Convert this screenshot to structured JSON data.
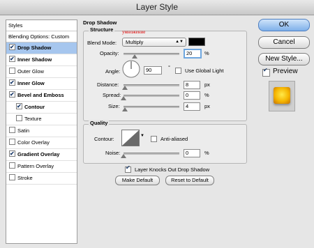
{
  "window": {
    "title": "Layer Style"
  },
  "sidebar": {
    "header": "Styles",
    "blending": "Blending Options: Custom",
    "items": [
      {
        "label": "Drop Shadow",
        "checked": true,
        "selected": true
      },
      {
        "label": "Inner Shadow",
        "checked": true
      },
      {
        "label": "Outer Glow",
        "checked": false
      },
      {
        "label": "Inner Glow",
        "checked": true
      },
      {
        "label": "Bevel and Emboss",
        "checked": true
      },
      {
        "label": "Contour",
        "checked": true,
        "sub": true
      },
      {
        "label": "Texture",
        "checked": false,
        "sub": true
      },
      {
        "label": "Satin",
        "checked": false
      },
      {
        "label": "Color Overlay",
        "checked": false
      },
      {
        "label": "Gradient Overlay",
        "checked": true
      },
      {
        "label": "Pattern Overlay",
        "checked": false
      },
      {
        "label": "Stroke",
        "checked": false
      }
    ]
  },
  "drop_shadow": {
    "title": "Drop Shadow",
    "structure": {
      "title": "Structure",
      "blend_mode_label": "Blend Mode:",
      "blend_mode_value": "Multiply",
      "annotation": "умножение",
      "opacity_label": "Opacity:",
      "opacity_value": "20",
      "opacity_unit": "%",
      "angle_label": "Angle:",
      "angle_value": "90",
      "angle_unit": "°",
      "global_light_label": "Use Global Light",
      "distance_label": "Distance:",
      "distance_value": "8",
      "distance_unit": "px",
      "spread_label": "Spread:",
      "spread_value": "0",
      "spread_unit": "%",
      "size_label": "Size:",
      "size_value": "4",
      "size_unit": "px"
    },
    "quality": {
      "title": "Quality",
      "contour_label": "Contour:",
      "anti_aliased_label": "Anti-aliased",
      "noise_label": "Noise:",
      "noise_value": "0",
      "noise_unit": "%"
    },
    "knocks_out_label": "Layer Knocks Out Drop Shadow",
    "make_default_label": "Make Default",
    "reset_default_label": "Reset to Default"
  },
  "actions": {
    "ok_label": "OK",
    "cancel_label": "Cancel",
    "new_style_label": "New Style...",
    "preview_label": "Preview"
  },
  "sliders": {
    "opacity": 0.2,
    "distance": 0.03,
    "spread": 0.0,
    "size": 0.02,
    "noise": 0.0
  },
  "colors": {
    "shadow": "#000000",
    "selection": "#a6c6ee",
    "preview_glow": "#f5b500"
  }
}
